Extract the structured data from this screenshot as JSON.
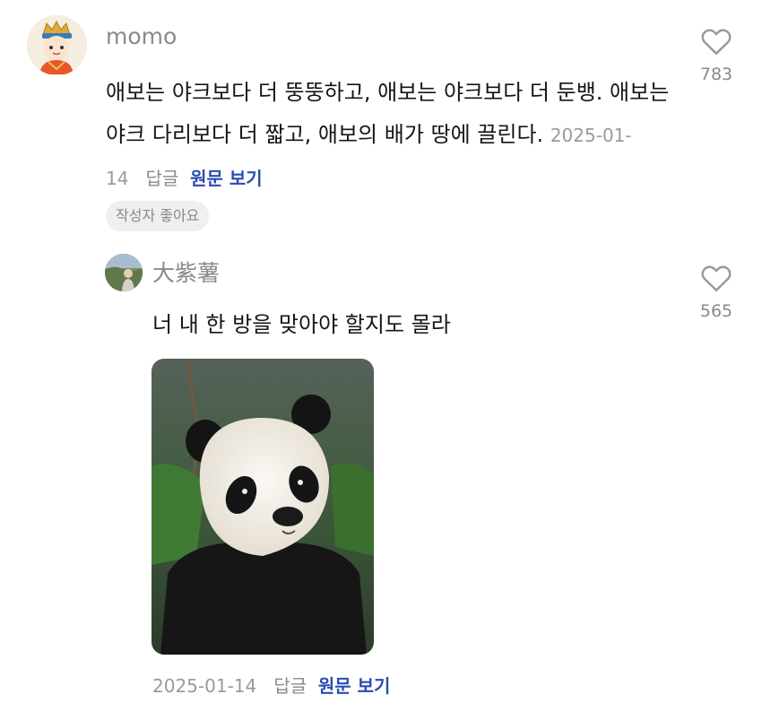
{
  "comment": {
    "username": "momo",
    "text": "애보는 야크보다 더 뚱뚱하고, 애보는 야크보다 더 둔뱅. 애보는 야크 다리보다 더 짧고, 애보의 배가 땅에 끌린다.",
    "date": "2025-01-14",
    "reply_label": "답글",
    "original_label": "원문 보기",
    "author_liked_label": "작성자 좋아요",
    "like_count": "783",
    "like_icon": "heart-outline-icon"
  },
  "reply": {
    "username": "大紫薯",
    "text": "너 내 한 방을 맞아야 할지도 몰라",
    "date": "2025-01-14",
    "reply_label": "답글",
    "original_label": "원문 보기",
    "like_count": "565",
    "like_icon": "heart-outline-icon"
  },
  "colors": {
    "muted": "#8a8a8a",
    "link": "#2b4cb3",
    "text": "#161616"
  }
}
